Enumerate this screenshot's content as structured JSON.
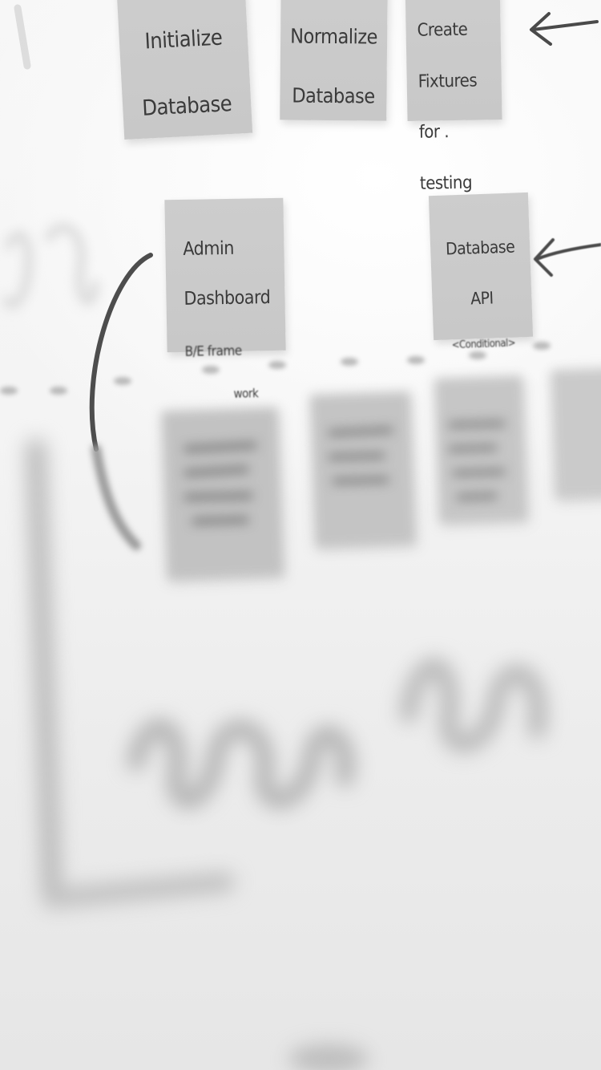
{
  "board": {
    "top_row": [
      {
        "id": "init-db",
        "lines": [
          "Initialize",
          "Database"
        ]
      },
      {
        "id": "normalize-db",
        "lines": [
          "Normalize",
          "Database"
        ]
      },
      {
        "id": "create-fixtures",
        "lines": [
          "Create",
          "Fixtures",
          "for .",
          "testing"
        ]
      }
    ],
    "middle_row": [
      {
        "id": "admin-dashboard",
        "lines": [
          "Admin",
          "Dashboard",
          "B/E frame",
          "work"
        ]
      },
      {
        "id": "database-api",
        "lines": [
          "Database",
          "API",
          "<Conditional>"
        ]
      }
    ]
  },
  "colors": {
    "sticky_note": "#cacaca",
    "marker": "#3a3a3a",
    "wall": "#f4f4f4"
  },
  "icons": [
    "arrow-left-icon",
    "arrow-left-icon",
    "curved-arrow-icon"
  ]
}
